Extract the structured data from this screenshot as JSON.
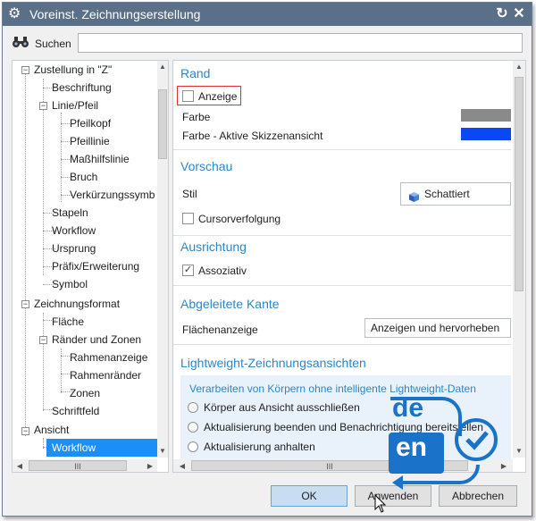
{
  "window": {
    "title": "Voreinst. Zeichnungserstellung",
    "gear_icon": "gear-icon",
    "reset_icon": "reset-icon",
    "close_icon": "close-icon"
  },
  "search": {
    "label": "Suchen",
    "value": "",
    "placeholder": "",
    "icon": "binoculars-icon"
  },
  "tree": {
    "items": [
      {
        "label": "Zustellung in \"Z\""
      },
      {
        "label": "Beschriftung"
      },
      {
        "label": "Linie/Pfeil"
      },
      {
        "label": "Pfeilkopf"
      },
      {
        "label": "Pfeillinie"
      },
      {
        "label": "Maßhilfslinie"
      },
      {
        "label": "Bruch"
      },
      {
        "label": "Verkürzungssymb"
      },
      {
        "label": "Stapeln"
      },
      {
        "label": "Workflow"
      },
      {
        "label": "Ursprung"
      },
      {
        "label": "Präfix/Erweiterung"
      },
      {
        "label": "Symbol"
      },
      {
        "label": "Zeichnungsformat"
      },
      {
        "label": "Fläche"
      },
      {
        "label": "Ränder und Zonen"
      },
      {
        "label": "Rahmenanzeige"
      },
      {
        "label": "Rahmenränder"
      },
      {
        "label": "Zonen"
      },
      {
        "label": "Schriftfeld"
      },
      {
        "label": "Ansicht"
      },
      {
        "label": "Workflow",
        "selected": true
      }
    ]
  },
  "rand": {
    "heading": "Rand",
    "anzeige_label": "Anzeige",
    "farbe_label": "Farbe",
    "farbe_color": "#8a8a8a",
    "farbe_aktiv_label": "Farbe - Aktive Skizzenansicht",
    "farbe_aktiv_color": "#0a47f5"
  },
  "vorschau": {
    "heading": "Vorschau",
    "stil_label": "Stil",
    "stil_value": "Schattiert",
    "cursor_label": "Cursorverfolgung"
  },
  "ausrichtung": {
    "heading": "Ausrichtung",
    "assoziativ_label": "Assoziativ",
    "assoziativ_checked": "✓"
  },
  "kante": {
    "heading": "Abgeleitete Kante",
    "flaechen_label": "Flächenanzeige",
    "flaechen_value": "Anzeigen und hervorheben"
  },
  "lightweight": {
    "heading": "Lightweight-Zeichnungsansichten",
    "subheading": "Verarbeiten von Körpern ohne intelligente Lightweight-Daten",
    "options": [
      "Körper aus Ansicht ausschließen",
      "Aktualisierung beenden und Benachrichtigung bereitstellen",
      "Aktualisierung anhalten"
    ]
  },
  "buttons": {
    "ok": "OK",
    "apply": "Anwenden",
    "cancel": "Abbrechen"
  },
  "badge": {
    "top": "de",
    "bottom": "en"
  },
  "colors": {
    "accent": "#2d87c7",
    "titlebar": "#5a6f88",
    "selection": "#1c8ef7"
  }
}
